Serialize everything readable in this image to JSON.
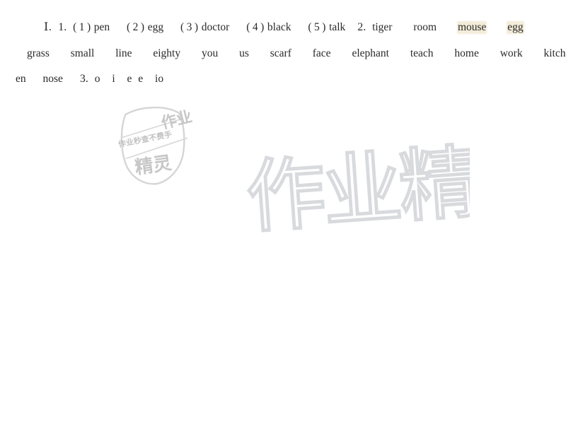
{
  "document": {
    "type": "scanned-answer-key",
    "background_color": "#ffffff",
    "text_color": "#2a2a2a"
  },
  "answers": {
    "line1": {
      "section_label": "Ⅰ.",
      "group1_number": "1.",
      "items": [
        {
          "marker": "( 1 )",
          "answer": "pen"
        },
        {
          "marker": "( 2 )",
          "answer": "egg"
        },
        {
          "marker": "( 3 )",
          "answer": "doctor"
        },
        {
          "marker": "( 4 )",
          "answer": "black"
        },
        {
          "marker": "( 5 )",
          "answer": "talk"
        }
      ],
      "group2_number": "2.",
      "group2_words": [
        "tiger",
        "room",
        "mouse",
        "egg"
      ]
    },
    "line2": {
      "words": [
        "grass",
        "small",
        "line",
        "eighty",
        "you",
        "us",
        "scarf",
        "face",
        "elephant",
        "teach",
        "home",
        "work",
        "kitch-"
      ]
    },
    "line3": {
      "words": [
        "en",
        "nose"
      ],
      "group3_number": "3.",
      "group3_answers": [
        "o",
        "i",
        "e",
        "e",
        "io"
      ]
    }
  },
  "watermarks": {
    "stamp": {
      "shape": "shield",
      "top_text": "作业",
      "band_text": "作业秒查不费手",
      "bottom_text": "精灵",
      "color": "#9a9a9a"
    },
    "big": {
      "text": "作业精灵",
      "style": "outline",
      "stroke_color": "#d8dadd"
    }
  },
  "tint_color": "#f3ecd9"
}
